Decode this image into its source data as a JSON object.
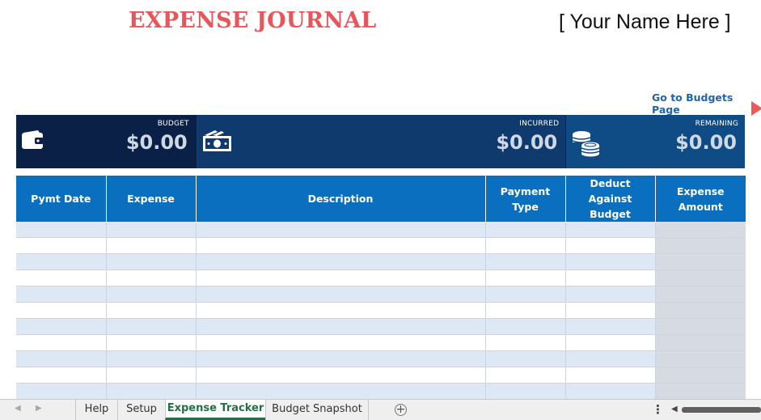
{
  "header": {
    "title": "EXPENSE JOURNAL",
    "name_placeholder": "[ Your Name Here ]",
    "goto_link": "Go to Budgets Page"
  },
  "stats": {
    "budget": {
      "label": "BUDGET",
      "value": "$0.00",
      "icon": "wallet-icon"
    },
    "incurred": {
      "label": "INCURRED",
      "value": "$0.00",
      "icon": "cash-icon"
    },
    "remaining": {
      "label": "REMAINING",
      "value": "$0.00",
      "icon": "coins-icon"
    }
  },
  "table": {
    "columns": [
      "Pymt Date",
      "Expense",
      "Description",
      "Payment Type",
      "Deduct Against Budget",
      "Expense Amount"
    ]
  },
  "sheet_tabs": {
    "tabs": [
      "Help",
      "Setup",
      "Expense Tracker",
      "Budget Snapshot"
    ],
    "active": "Expense Tracker"
  },
  "colors": {
    "title": "#e8555a",
    "budget_bg": "#0b2046",
    "incurred_bg": "#0e3a6d",
    "remaining_bg": "#0f4b84",
    "header_bg": "#0b6fbf",
    "row_band": "#dde8f4",
    "active_tab": "#207245"
  }
}
